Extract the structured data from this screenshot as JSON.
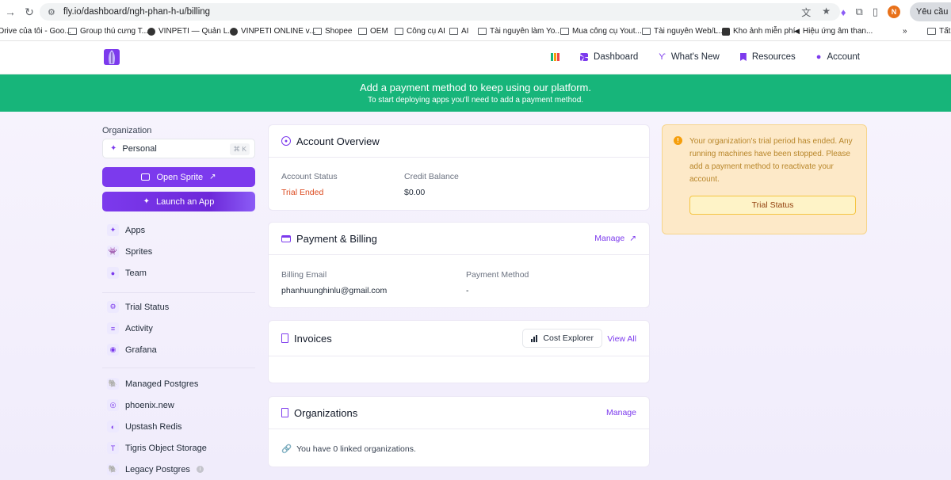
{
  "browser": {
    "url": "fly.io/dashboard/ngh-phan-h-u/billing",
    "profile_initial": "N",
    "request_label": "Yêu cầu hỗ",
    "bookmarks": [
      "Drive của tôi - Goo...",
      "Group thú cưng T...",
      "VINPETI — Quản L...",
      "VINPETI ONLINE v...",
      "Shopee",
      "OEM",
      "Công cụ AI",
      "AI",
      "Tài nguyên làm Yo...",
      "Mua công cụ Yout...",
      "Tài nguyên Web/L...",
      "Kho ảnh miễn phí",
      "Hiệu ứng âm than..."
    ],
    "bookmarks_more": "»",
    "bookmarks_last": "Tất"
  },
  "header": {
    "nav": [
      {
        "label": "Dashboard",
        "icon": "grid-icon"
      },
      {
        "label": "What's New",
        "icon": "sparkle-icon"
      },
      {
        "label": "Resources",
        "icon": "bookmark-icon"
      },
      {
        "label": "Account",
        "icon": "user-icon"
      }
    ]
  },
  "banner": {
    "title": "Add a payment method to keep using our platform.",
    "subtitle": "To start deploying apps you'll need to add a payment method."
  },
  "sidebar": {
    "org_label": "Organization",
    "org_value": "Personal",
    "org_shortcut": "⌘ K",
    "open_sprite": "Open Sprite",
    "launch_app": "Launch an App",
    "group1": [
      "Apps",
      "Sprites",
      "Team"
    ],
    "group2": [
      "Trial Status",
      "Activity",
      "Grafana"
    ],
    "group3": [
      "Managed Postgres",
      "phoenix.new",
      "Upstash Redis",
      "Tigris Object Storage",
      "Legacy Postgres"
    ]
  },
  "account_overview": {
    "title": "Account Overview",
    "status_label": "Account Status",
    "status_value": "Trial Ended",
    "balance_label": "Credit Balance",
    "balance_value": "$0.00"
  },
  "billing": {
    "title": "Payment & Billing",
    "manage": "Manage",
    "email_label": "Billing Email",
    "email_value": "phanhuunghinlu@gmail.com",
    "method_label": "Payment Method",
    "method_value": "-"
  },
  "invoices": {
    "title": "Invoices",
    "cost_explorer": "Cost Explorer",
    "view_all": "View All"
  },
  "organizations": {
    "title": "Organizations",
    "manage": "Manage",
    "empty_text": "You have 0 linked organizations."
  },
  "trial_notice": {
    "message": "Your organization's trial period has ended. Any running machines have been stopped. Please add a payment method to reactivate your account.",
    "button": "Trial Status"
  },
  "colors": {
    "accent": "#7c3aed",
    "banner": "#17b57a",
    "status_ended": "#dc4a1f",
    "notice_bg": "#fde9c8"
  }
}
